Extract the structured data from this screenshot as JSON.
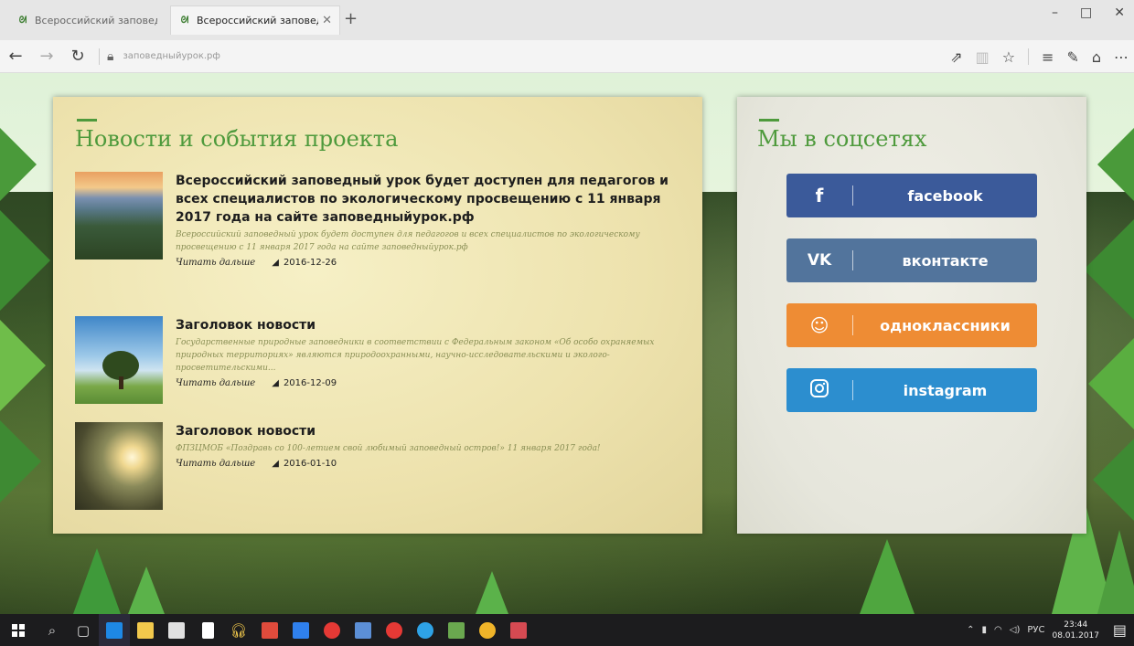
{
  "browser": {
    "tabs": [
      {
        "label": "Всероссийский заповедны",
        "active": false
      },
      {
        "label": "Всероссийский заповедный урок",
        "active": true
      }
    ],
    "url": "заповедныйурок.рф",
    "window_controls": [
      "–",
      "□",
      "✕"
    ]
  },
  "page": {
    "news": {
      "title": "Новости и события проекта",
      "items": [
        {
          "title": "Всероссийский заповедный урок будет доступен для педагогов и всех специалистов по экологическому просвещению с 11 января 2017 года на сайте заповедныйурок.рф",
          "excerpt": "Всероссийский заповедный урок будет доступен для педагогов и всех специалистов по экологическому просвещению с 11 января 2017 года на сайте заповедныйурок.рф",
          "read_more": "Читать дальше",
          "date": "2016-12-26"
        },
        {
          "title": "Заголовок новости",
          "excerpt": "Государственные природные заповедники в соответствии с Федеральным законом «Об особо охраняемых природных территориях» являются природоохранными, научно-исследовательскими и эколого-просветительскими...",
          "read_more": "Читать дальше",
          "date": "2016-12-09"
        },
        {
          "title": "Заголовок новости",
          "excerpt": "ФПЗЦМОБ «Поздравь со 100-летием свой любимый заповедный остров!» 11 января 2017 года!",
          "read_more": "Читать дальше",
          "date": "2016-01-10"
        }
      ]
    },
    "social": {
      "title": "Мы в соцсетях",
      "buttons": [
        {
          "label": "facebook",
          "icon": "f",
          "color": "#3b5a9a"
        },
        {
          "label": "вконтакте",
          "icon": "vk",
          "color": "#52749c"
        },
        {
          "label": "одноклассники",
          "icon": "ok",
          "color": "#ee8c34"
        },
        {
          "label": "instagram",
          "icon": "instagram",
          "color": "#2c8ecf"
        }
      ]
    }
  },
  "taskbar": {
    "tray_lang": "РУС",
    "time": "23:44",
    "date": "08.01.2017"
  }
}
